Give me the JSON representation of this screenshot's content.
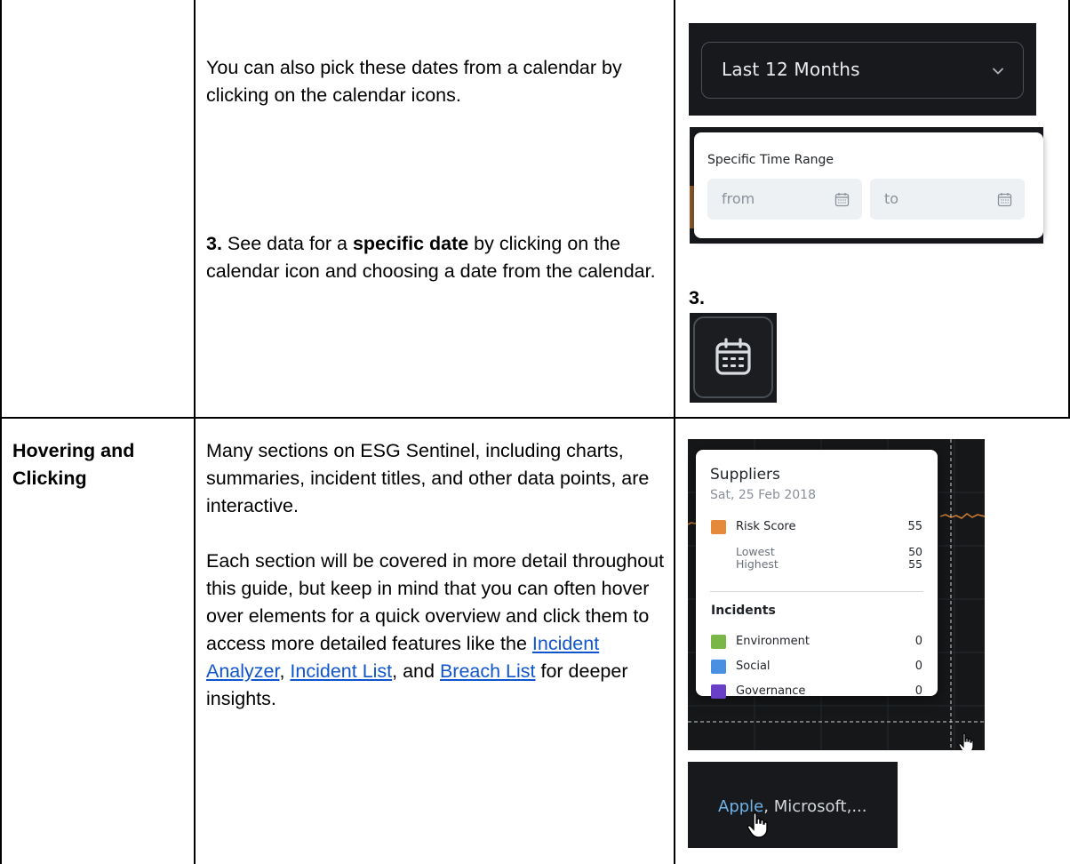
{
  "rows": [
    {
      "heading": "",
      "paragraph_1": "You can also pick these dates from a calendar by clicking on the calendar icons.",
      "step_number": "3.",
      "step_text_a": " See data for a ",
      "step_text_bold": "specific date",
      "step_text_b": " by clicking on the calendar icon and choosing a date from the calendar."
    },
    {
      "heading": "Hovering and Clicking",
      "paragraph_1": "Many sections on ESG Sentinel, including charts, summaries, incident titles, and other data points, are interactive.",
      "paragraph_2_a": "Each section will be covered in more detail throughout this guide, but keep in mind that you can often hover over elements for a quick overview and click them to access more detailed features like the ",
      "link_incident_analyzer": "Incident Analyzer",
      "sep_1": ", ",
      "link_incident_list": "Incident List",
      "sep_2": ", and ",
      "link_breach_list": "Breach List",
      "paragraph_2_b": " for deeper insights."
    }
  ],
  "screenshots": {
    "dropdown": {
      "label": "Last 12 Months",
      "icon": "chevron-down-icon"
    },
    "range_picker": {
      "title": "Specific Time Range",
      "from_placeholder": "from",
      "to_placeholder": "to",
      "icon": "calendar-icon"
    },
    "step_label": "3.",
    "calendar_button": {
      "icon": "calendar-icon"
    },
    "tooltip": {
      "title": "Suppliers",
      "date": "Sat, 25 Feb 2018",
      "risk_label": "Risk Score",
      "risk_value": "55",
      "lowest_label": "Lowest",
      "lowest_value": "50",
      "highest_label": "Highest",
      "highest_value": "55",
      "incidents_heading": "Incidents",
      "incidents": [
        {
          "label": "Environment",
          "value": "0",
          "color": "#7ab648"
        },
        {
          "label": "Social",
          "value": "0",
          "color": "#4a90e2"
        },
        {
          "label": "Governance",
          "value": "0",
          "color": "#6a3fc8"
        }
      ],
      "risk_color": "#e58a3a"
    },
    "company_list": {
      "first": "Apple",
      "rest": ", Microsoft,..."
    }
  }
}
